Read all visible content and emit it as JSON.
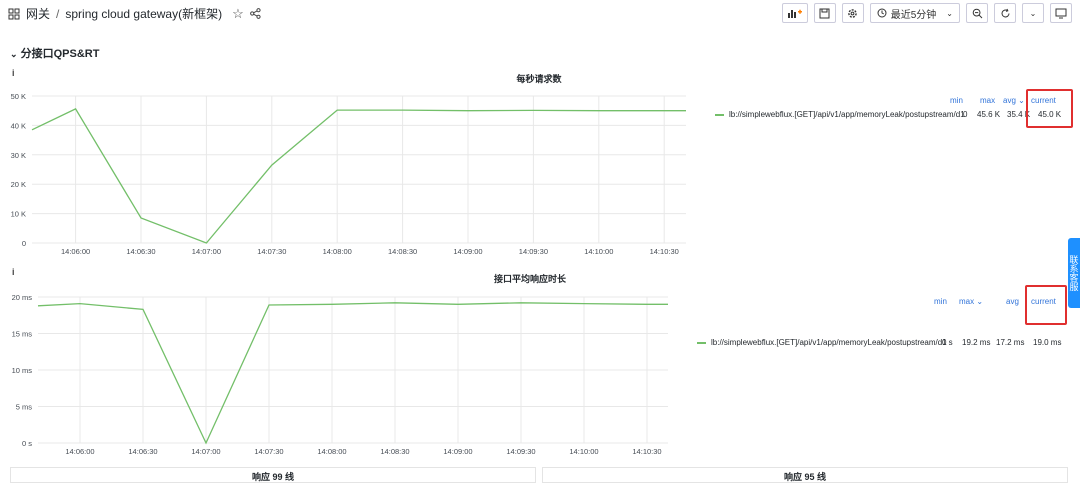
{
  "breadcrumb": {
    "folder": "网关",
    "separator": "/",
    "dashboard": "spring cloud gateway(新框架)"
  },
  "toolbar": {
    "time_range": "最近5分钟"
  },
  "row": {
    "title": "分接口QPS&RT"
  },
  "panels": [
    {
      "title": "每秒请求数",
      "info": "i",
      "y_ticks": [
        "50 K",
        "40 K",
        "30 K",
        "20 K",
        "10 K",
        "0"
      ],
      "x_ticks": [
        "14:06:00",
        "14:06:30",
        "14:07:00",
        "14:07:30",
        "14:08:00",
        "14:08:30",
        "14:09:00",
        "14:09:30",
        "14:10:00",
        "14:10:30"
      ],
      "legend": {
        "headers": {
          "min": "min",
          "max": "max",
          "avg": "avg ⌄",
          "current": "current"
        },
        "series": "lb://simplewebflux.[GET]/api/v1/app/memoryLeak/postupstream/d1",
        "min": "0",
        "max": "45.6 K",
        "avg": "35.4 K",
        "current": "45.0 K"
      }
    },
    {
      "title": "接口平均响应时长",
      "info": "i",
      "y_ticks": [
        "20 ms",
        "15 ms",
        "10 ms",
        "5 ms",
        "0 s"
      ],
      "x_ticks": [
        "14:06:00",
        "14:06:30",
        "14:07:00",
        "14:07:30",
        "14:08:00",
        "14:08:30",
        "14:09:00",
        "14:09:30",
        "14:10:00",
        "14:10:30"
      ],
      "legend": {
        "headers": {
          "min": "min",
          "max": "max ⌄",
          "avg": "avg",
          "current": "current"
        },
        "series": "lb://simplewebflux.[GET]/api/v1/app/memoryLeak/postupstream/d1",
        "min": "0 s",
        "max": "19.2 ms",
        "avg": "17.2 ms",
        "current": "19.0 ms"
      }
    }
  ],
  "bottom_panels": [
    "响应 99 线",
    "响应 95 线"
  ],
  "side_tab": "联系客服",
  "chart_data": [
    {
      "type": "line",
      "title": "每秒请求数",
      "x": [
        "14:05:40",
        "14:06:00",
        "14:06:30",
        "14:07:00",
        "14:07:30",
        "14:08:00",
        "14:08:30",
        "14:09:00",
        "14:09:30",
        "14:10:00",
        "14:10:30",
        "14:10:40"
      ],
      "series": [
        {
          "name": "lb://simplewebflux.[GET]/api/v1/app/memoryLeak/postupstream/d1",
          "values": [
            38500,
            45600,
            8500,
            0,
            26500,
            45200,
            45200,
            45000,
            45100,
            45000,
            45000,
            45000
          ]
        }
      ],
      "ylim": [
        0,
        50000
      ],
      "color": "#73bf69"
    },
    {
      "type": "line",
      "title": "接口平均响应时长",
      "x": [
        "14:05:40",
        "14:06:00",
        "14:06:30",
        "14:07:00",
        "14:07:30",
        "14:08:00",
        "14:08:30",
        "14:09:00",
        "14:09:30",
        "14:10:00",
        "14:10:30",
        "14:10:40"
      ],
      "series": [
        {
          "name": "lb://simplewebflux.[GET]/api/v1/app/memoryLeak/postupstream/d1",
          "values": [
            18.8,
            19.1,
            18.3,
            0,
            18.9,
            19.0,
            19.2,
            19.0,
            19.2,
            19.1,
            19.0,
            19.0
          ]
        }
      ],
      "ylim": [
        0,
        20
      ],
      "unit": "ms",
      "color": "#73bf69"
    }
  ]
}
